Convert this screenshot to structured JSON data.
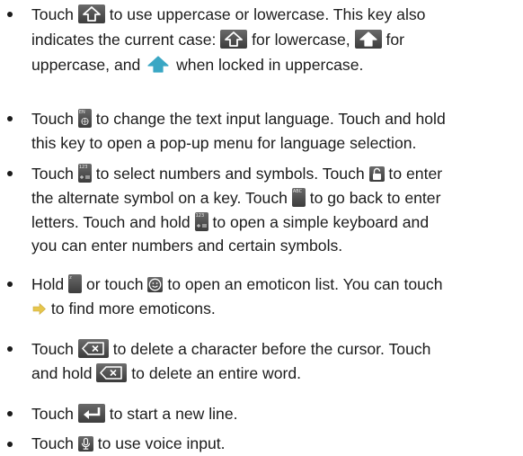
{
  "items": [
    {
      "lines": [
        [
          "Touch ",
          "{shift-outline}",
          " to use uppercase or lowercase. This key also"
        ],
        [
          "indicates the current case: ",
          "{shift-outline}",
          " for lowercase, ",
          "{shift-filled}",
          " for"
        ],
        [
          "uppercase, and ",
          "{shift-locked}",
          " when locked in uppercase."
        ]
      ]
    },
    {
      "lines": [
        [
          "Touch ",
          "{language}",
          " to change the text input language. Touch and hold"
        ],
        [
          "this key to open a pop-up menu for language selection."
        ]
      ]
    },
    {
      "lines": [
        [
          "Touch ",
          "{symbols}",
          " to select numbers and symbols. Touch ",
          "{alt-lock}",
          " to enter"
        ],
        [
          "the alternate symbol on a key. Touch ",
          "{abc}",
          " to go back to enter"
        ],
        [
          "letters. Touch and hold ",
          "{symbols}",
          " to open a simple keyboard and"
        ],
        [
          "you can enter numbers and certain symbols."
        ]
      ]
    },
    {
      "lines": [
        [
          "Hold ",
          "{z-key}",
          " or touch ",
          "{emoticon}",
          " to open an emoticon list. You can touch"
        ],
        [
          "{arrow-right}",
          " to find more emoticons."
        ]
      ]
    },
    {
      "lines": [
        [
          "Touch ",
          "{delete}",
          " to delete a character before the cursor. Touch"
        ],
        [
          "and hold ",
          "{delete}",
          " to delete an entire word."
        ]
      ]
    },
    {
      "lines": [
        [
          "Touch ",
          "{enter}",
          " to start a new line."
        ]
      ]
    },
    {
      "lines": [
        [
          "Touch ",
          "{mic}",
          " to use voice input."
        ]
      ]
    }
  ],
  "icons": {
    "language": {
      "name": "language-key-icon",
      "text": "EN"
    },
    "symbols": {
      "name": "symbols-key-icon",
      "text": "123"
    },
    "abc": {
      "name": "abc-key-icon",
      "text": "ABC"
    },
    "z-key": {
      "name": "z-key-icon",
      "text": "z"
    },
    "shift-outline": {
      "name": "shift-outline-icon"
    },
    "shift-filled": {
      "name": "shift-filled-icon"
    },
    "shift-locked": {
      "name": "shift-locked-icon"
    },
    "alt-lock": {
      "name": "alt-lock-icon"
    },
    "emoticon": {
      "name": "emoticon-icon"
    },
    "arrow-right": {
      "name": "arrow-right-icon"
    },
    "delete": {
      "name": "delete-key-icon"
    },
    "enter": {
      "name": "enter-key-icon"
    },
    "mic": {
      "name": "microphone-icon"
    }
  },
  "colors": {
    "text": "#1b1b1b",
    "key_dark": "#4a4a4a",
    "accent_teal": "#3aa7c4",
    "arrow_yellow": "#e6c64c"
  }
}
